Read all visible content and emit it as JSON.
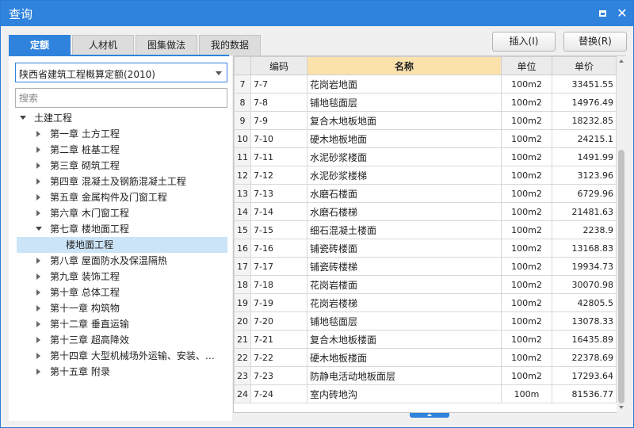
{
  "window": {
    "title": "查询"
  },
  "tabs": [
    "定额",
    "人材机",
    "图集做法",
    "我的数据"
  ],
  "buttons": {
    "insert": "插入(I)",
    "replace": "替换(R)"
  },
  "combo": {
    "value": "陕西省建筑工程概算定额(2010)"
  },
  "search": {
    "placeholder": "搜索"
  },
  "tree": [
    {
      "label": "土建工程",
      "level": 0,
      "state": "expanded"
    },
    {
      "label": "第一章  土方工程",
      "level": 1,
      "state": "collapsed"
    },
    {
      "label": "第二章  桩基工程",
      "level": 1,
      "state": "collapsed"
    },
    {
      "label": "第三章  砌筑工程",
      "level": 1,
      "state": "collapsed"
    },
    {
      "label": "第四章  混凝土及钢筋混凝土工程",
      "level": 1,
      "state": "collapsed"
    },
    {
      "label": "第五章  金属构件及门窗工程",
      "level": 1,
      "state": "collapsed"
    },
    {
      "label": "第六章  木门窗工程",
      "level": 1,
      "state": "collapsed"
    },
    {
      "label": "第七章  楼地面工程",
      "level": 1,
      "state": "expanded"
    },
    {
      "label": "楼地面工程",
      "level": 2,
      "state": "leaf",
      "selected": true
    },
    {
      "label": "第八章  屋面防水及保温隔热",
      "level": 1,
      "state": "collapsed"
    },
    {
      "label": "第九章  装饰工程",
      "level": 1,
      "state": "collapsed"
    },
    {
      "label": "第十章  总体工程",
      "level": 1,
      "state": "collapsed"
    },
    {
      "label": "第十一章  构筑物",
      "level": 1,
      "state": "collapsed"
    },
    {
      "label": "第十二章  垂直运输",
      "level": 1,
      "state": "collapsed"
    },
    {
      "label": "第十三章  超高降效",
      "level": 1,
      "state": "collapsed"
    },
    {
      "label": "第十四章  大型机械场外运输、安装、…",
      "level": 1,
      "state": "collapsed"
    },
    {
      "label": "第十五章  附录",
      "level": 1,
      "state": "collapsed"
    }
  ],
  "table": {
    "columns": [
      "",
      "编码",
      "名称",
      "单位",
      "单价"
    ],
    "rows": [
      [
        "7",
        "7-7",
        "花岗岩地面",
        "100m2",
        "33451.55"
      ],
      [
        "8",
        "7-8",
        "铺地毯面层",
        "100m2",
        "14976.49"
      ],
      [
        "9",
        "7-9",
        "复合木地板地面",
        "100m2",
        "18232.85"
      ],
      [
        "10",
        "7-10",
        "硬木地板地面",
        "100m2",
        "24215.1"
      ],
      [
        "11",
        "7-11",
        "水泥砂浆楼面",
        "100m2",
        "1491.99"
      ],
      [
        "12",
        "7-12",
        "水泥砂浆楼梯",
        "100m2",
        "3123.96"
      ],
      [
        "13",
        "7-13",
        "水磨石楼面",
        "100m2",
        "6729.96"
      ],
      [
        "14",
        "7-14",
        "水磨石楼梯",
        "100m2",
        "21481.63"
      ],
      [
        "15",
        "7-15",
        "细石混凝土楼面",
        "100m2",
        "2238.9"
      ],
      [
        "16",
        "7-16",
        "铺瓷砖楼面",
        "100m2",
        "13168.83"
      ],
      [
        "17",
        "7-17",
        "铺瓷砖楼梯",
        "100m2",
        "19934.73"
      ],
      [
        "18",
        "7-18",
        "花岗岩楼面",
        "100m2",
        "30070.98"
      ],
      [
        "19",
        "7-19",
        "花岗岩楼梯",
        "100m2",
        "42805.5"
      ],
      [
        "20",
        "7-20",
        "铺地毯面层",
        "100m2",
        "13078.33"
      ],
      [
        "21",
        "7-21",
        "复合木地板楼面",
        "100m2",
        "16435.89"
      ],
      [
        "22",
        "7-22",
        "硬木地板楼面",
        "100m2",
        "22378.69"
      ],
      [
        "23",
        "7-23",
        "防静电活动地板面层",
        "100m2",
        "17293.64"
      ],
      [
        "24",
        "7-24",
        "室内砖地沟",
        "100m",
        "81536.77"
      ]
    ]
  },
  "colors": {
    "accent": "#2f83dc",
    "header_highlight": "#fbe2ad",
    "selection": "#cce4f7"
  }
}
